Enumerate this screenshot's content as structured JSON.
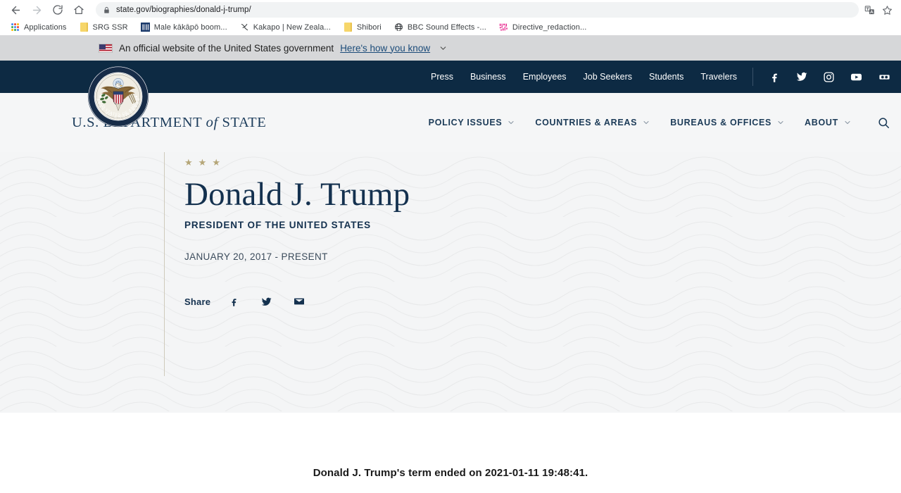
{
  "browser": {
    "back_label": "Back",
    "forward_label": "Forward",
    "reload_label": "Reload",
    "home_label": "Home",
    "url": "state.gov/biographies/donald-j-trump/",
    "lock_icon": "lock-icon",
    "translate_icon": "translate-icon",
    "bookmark_star_icon": "star-icon",
    "bookmarks": [
      {
        "label": "Applications",
        "icon": "apps-grid-icon"
      },
      {
        "label": "SRG SSR",
        "icon": "folder-icon"
      },
      {
        "label": "Male kākāpō boom...",
        "icon": "site-favicon"
      },
      {
        "label": "Kakapo | New Zeala...",
        "icon": "site-favicon"
      },
      {
        "label": "Shibori",
        "icon": "folder-icon"
      },
      {
        "label": "BBC Sound Effects -...",
        "icon": "globe-icon"
      },
      {
        "label": "Directive_redaction...",
        "icon": "site-favicon"
      }
    ]
  },
  "gov_banner": {
    "flag_icon": "us-flag-icon",
    "text": "An official website of the United States government",
    "link_label": "Here's how you know",
    "chevron_icon": "chevron-down-icon"
  },
  "utility_bar": {
    "links": [
      {
        "label": "Press"
      },
      {
        "label": "Business"
      },
      {
        "label": "Employees"
      },
      {
        "label": "Job Seekers"
      },
      {
        "label": "Students"
      },
      {
        "label": "Travelers"
      }
    ],
    "social": [
      {
        "name": "facebook-icon",
        "label": "Facebook"
      },
      {
        "name": "twitter-icon",
        "label": "Twitter"
      },
      {
        "name": "instagram-icon",
        "label": "Instagram"
      },
      {
        "name": "youtube-icon",
        "label": "YouTube"
      },
      {
        "name": "flickr-icon",
        "label": "Flickr"
      }
    ]
  },
  "masthead": {
    "seal_alt": "Seal of the U.S. Department of State",
    "wordmark_part1": "U.S. DEPARTMENT",
    "wordmark_of": "of",
    "wordmark_part2": "STATE",
    "nav": [
      {
        "label": "POLICY ISSUES"
      },
      {
        "label": "COUNTRIES & AREAS"
      },
      {
        "label": "BUREAUS & OFFICES"
      },
      {
        "label": "ABOUT"
      }
    ],
    "search_icon": "search-icon"
  },
  "hero": {
    "stars": [
      "★",
      "★",
      "★"
    ],
    "name": "Donald J. Trump",
    "role": "PRESIDENT OF THE UNITED STATES",
    "dates": "JANUARY 20, 2017 - PRESENT",
    "share_label": "Share",
    "share": [
      {
        "name": "facebook-icon",
        "label": "Share on Facebook"
      },
      {
        "name": "twitter-icon",
        "label": "Share on Twitter"
      },
      {
        "name": "email-icon",
        "label": "Share by Email"
      }
    ]
  },
  "notice": {
    "text": "Donald J. Trump's term ended on 2021-01-11 19:48:41."
  },
  "colors": {
    "navy": "#0d2a43",
    "title_navy": "#14314f",
    "banner_gray": "#d6d7d9",
    "hero_gray": "#f4f5f6",
    "star_gold": "#b5a678",
    "link_blue": "#1b4b79"
  }
}
